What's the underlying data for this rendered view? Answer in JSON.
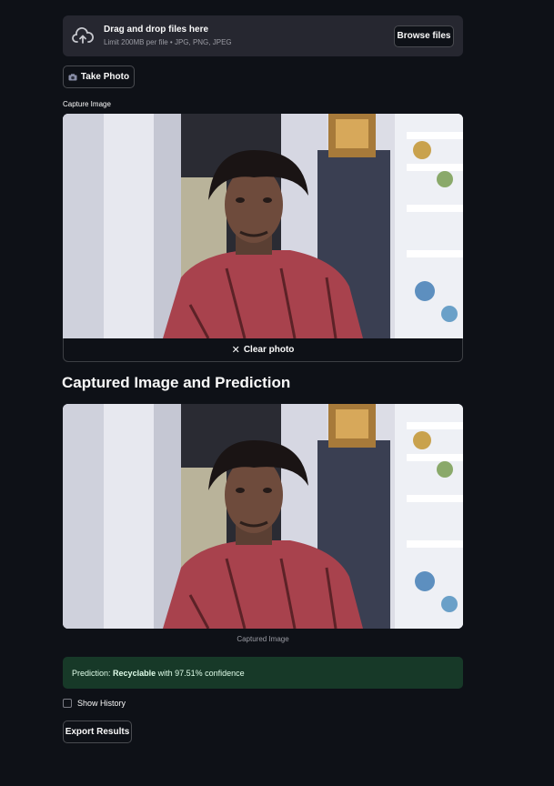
{
  "uploader": {
    "title": "Drag and drop files here",
    "subtitle": "Limit 200MB per file • JPG, PNG, JPEG",
    "browse_label": "Browse files",
    "icon": "cloud-upload-icon"
  },
  "camera": {
    "take_photo_label": "Take Photo",
    "capture_label": "Capture Image",
    "clear_label": "Clear photo",
    "camera_icon": "camera-icon",
    "clear_icon": "close-icon"
  },
  "result": {
    "title": "Captured Image and Prediction",
    "caption": "Captured Image",
    "prediction_prefix": "Prediction:",
    "prediction_class": "Recyclable",
    "prediction_suffix": "with 97.51% confidence"
  },
  "controls": {
    "history_label": "Show History",
    "history_checked": false,
    "export_label": "Export Results"
  },
  "colors": {
    "background": "#0e1117",
    "panel": "#262730",
    "success_bg": "#173928",
    "success_text": "#dffde9"
  }
}
